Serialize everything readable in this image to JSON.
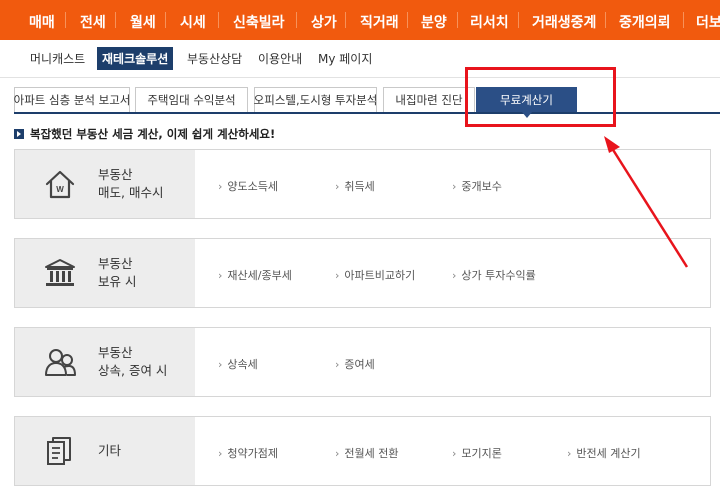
{
  "top_nav": {
    "items": [
      "매매",
      "전세",
      "월세",
      "시세",
      "신축빌라",
      "상가",
      "직거래",
      "분양",
      "리서치",
      "거래생중계",
      "중개의뢰",
      "더보"
    ]
  },
  "sub_nav": {
    "items": [
      "머니캐스트",
      "재테크솔루션",
      "부동산상담",
      "이용안내",
      "My 페이지"
    ],
    "active": "재테크솔루션"
  },
  "tabs": [
    "아파트 심층 분석 보고서",
    "주택임대 수익분석",
    "오피스텔,도시형 투자분석",
    "내집마련 진단",
    "무료계산기"
  ],
  "headline": "복잡했던 부동산 세금 계산, 이제 쉽게 계산하세요!",
  "cards": [
    {
      "icon": "house-icon",
      "title_line1": "부동산",
      "title_line2": "매도, 매수시",
      "links": [
        "양도소득세",
        "취득세",
        "중개보수"
      ]
    },
    {
      "icon": "bank-icon",
      "title_line1": "부동산",
      "title_line2": "보유 시",
      "links": [
        "재산세/종부세",
        "아파트비교하기",
        "상가 투자수익률"
      ]
    },
    {
      "icon": "people-icon",
      "title_line1": "부동산",
      "title_line2": "상속, 증여 시",
      "links": [
        "상속세",
        "증여세"
      ]
    },
    {
      "icon": "documents-icon",
      "title_line1": "기타",
      "title_line2": "",
      "links": [
        "청약가점제",
        "전월세 전환",
        "모기지론",
        "반전세 계산기"
      ]
    }
  ],
  "colors": {
    "nav_orange": "#f15a0e",
    "navy": "#1d3e6b",
    "annotation_red": "#e8141c"
  }
}
